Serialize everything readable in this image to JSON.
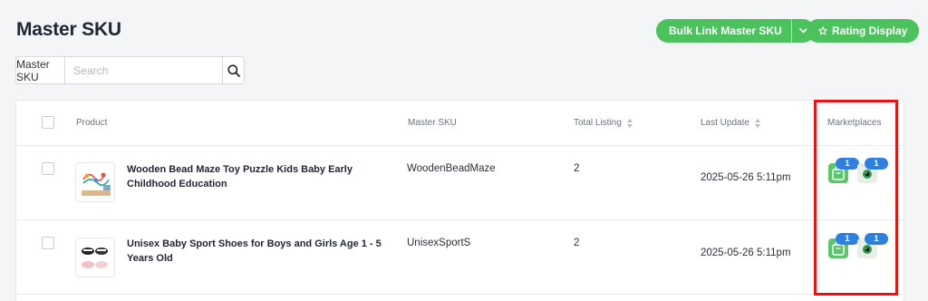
{
  "page": {
    "title": "Master SKU"
  },
  "header_buttons": {
    "bulk_link_label": "Bulk Link Master SKU",
    "rating_display_label": "Rating Display"
  },
  "search": {
    "label": "Master SKU",
    "placeholder": "Search"
  },
  "table": {
    "columns": {
      "product": "Product",
      "master_sku": "Master SKU",
      "total_listing": "Total Listing",
      "last_update": "Last Update",
      "marketplaces": "Marketplaces"
    },
    "rows": [
      {
        "product": "Wooden Bead Maze Toy Puzzle Kids Baby Early Childhood Education",
        "master_sku": "WoodenBeadMaze",
        "total_listing": "2",
        "last_update": "2025-05-26 5:11pm",
        "marketplaces": [
          {
            "icon": "shop-bag-icon",
            "count": "1"
          },
          {
            "icon": "eye-icon",
            "count": "1"
          }
        ]
      },
      {
        "product": "Unisex Baby Sport Shoes for Boys and Girls Age 1 - 5 Years Old",
        "master_sku": "UnisexSportS",
        "total_listing": "2",
        "last_update": "2025-05-26 5:11pm",
        "marketplaces": [
          {
            "icon": "shop-bag-icon",
            "count": "1"
          },
          {
            "icon": "eye-icon",
            "count": "1"
          }
        ]
      }
    ]
  },
  "colors": {
    "accent_green": "#4cc25c",
    "badge_blue": "#2d7fe0",
    "highlight_red": "#ee1111"
  }
}
